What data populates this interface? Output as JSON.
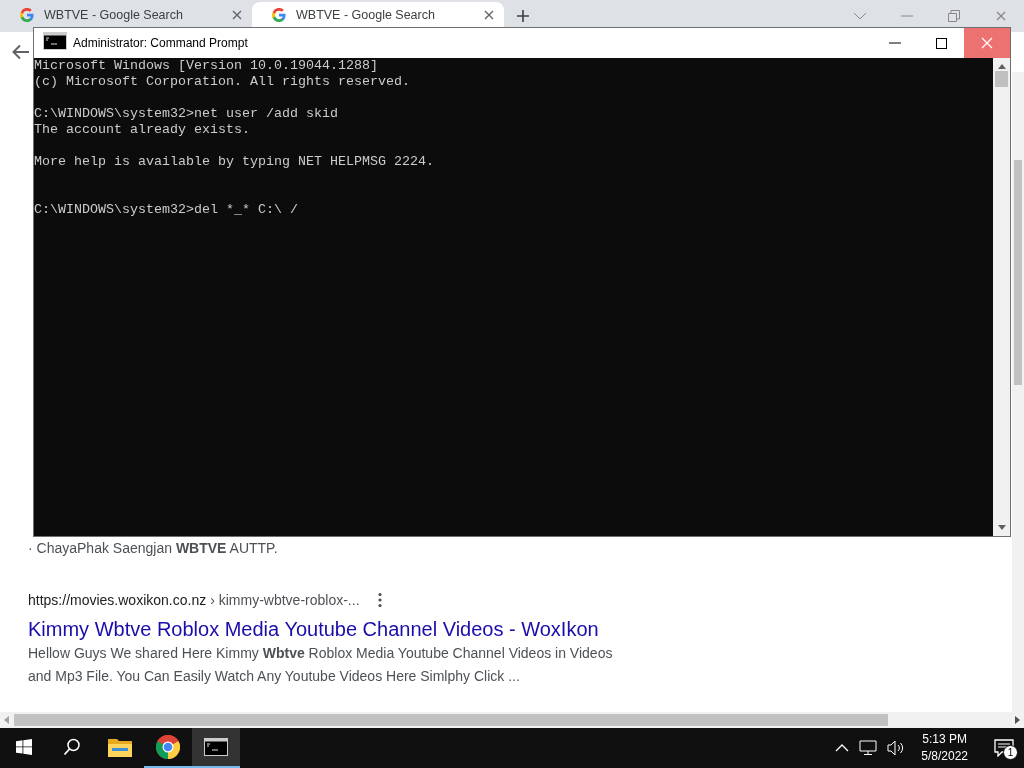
{
  "browser": {
    "tabs": [
      {
        "title": "WBTVE - Google Search",
        "selected": false
      },
      {
        "title": "WBTVE - Google Search",
        "selected": true
      }
    ],
    "results": {
      "snippet_tail": "· ChayaPhak Saengjan **WBTVE** AUTTP.",
      "result": {
        "site": "https://movies.woxikon.co.nz",
        "path": "› kimmy-wbtve-roblox-...",
        "title": "Kimmy Wbtve Roblox Media Youtube Channel Videos - WoxIkon",
        "snippet": "Hellow Guys We shared Here Kimmy **Wbtve** Roblox Media Youtube Channel Videos in Videos and Mp3 File. You Can Easily Watch Any Youtube Videos Here Simlphy Click ..."
      }
    }
  },
  "console_window": {
    "title": "Administrator: Command Prompt",
    "lines": [
      {
        "kind": "text",
        "text": "Microsoft Windows [Version 10.0.19044.1288]"
      },
      {
        "kind": "text",
        "text": "(c) Microsoft Corporation. All rights reserved."
      },
      {
        "kind": "blank"
      },
      {
        "kind": "text",
        "text": "C:\\WINDOWS\\system32>net user /add skid"
      },
      {
        "kind": "text",
        "text": "The account already exists."
      },
      {
        "kind": "blank"
      },
      {
        "kind": "text",
        "text": "More help is available by typing NET HELPMSG 2224."
      },
      {
        "kind": "blank"
      },
      {
        "kind": "blank"
      },
      {
        "kind": "text",
        "text": "C:\\WINDOWS\\system32>del *_* C:\\ /"
      }
    ]
  },
  "taskbar": {
    "apps": [
      {
        "kind": "start",
        "running": false,
        "selected": false
      },
      {
        "kind": "search",
        "running": false,
        "selected": false
      },
      {
        "kind": "explorer",
        "running": false,
        "selected": false
      },
      {
        "kind": "chrome",
        "running": true,
        "selected": false
      },
      {
        "kind": "console",
        "running": true,
        "selected": true
      }
    ],
    "time": "5:13 PM",
    "date": "5/8/2022",
    "notifications": "1"
  }
}
